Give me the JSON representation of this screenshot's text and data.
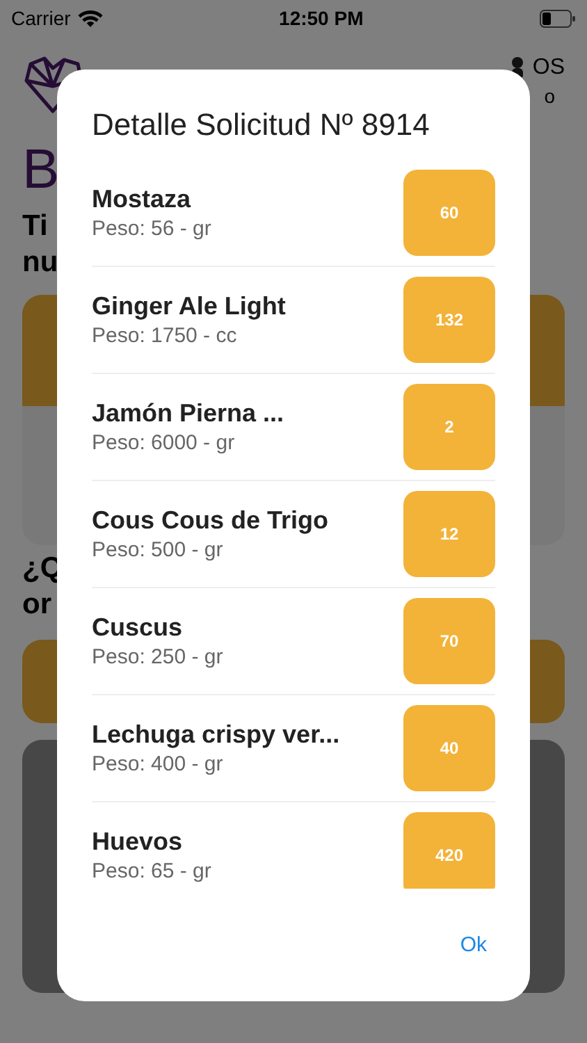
{
  "status_bar": {
    "carrier": "Carrier",
    "time": "12:50 PM"
  },
  "background": {
    "user_fragment": "OS",
    "user_fragment_2": "o",
    "heading_fragment": "B",
    "subtitle_fragments": [
      "Ti",
      "nu"
    ],
    "question_fragments": [
      "¿Q",
      "or"
    ]
  },
  "dialog": {
    "title": "Detalle Solicitud Nº 8914",
    "items": [
      {
        "name": "Mostaza",
        "weight": "Peso: 56 - gr",
        "quantity": "60"
      },
      {
        "name": "Ginger Ale Light",
        "weight": "Peso: 1750 - cc",
        "quantity": "132"
      },
      {
        "name": "Jamón Pierna ...",
        "weight": "Peso: 6000 - gr",
        "quantity": "2"
      },
      {
        "name": "Cous Cous de Trigo",
        "weight": "Peso: 500 - gr",
        "quantity": "12"
      },
      {
        "name": "Cuscus",
        "weight": "Peso: 250 - gr",
        "quantity": "70"
      },
      {
        "name": "Lechuga crispy ver...",
        "weight": "Peso: 400 - gr",
        "quantity": "40"
      },
      {
        "name": "Huevos",
        "weight": "Peso: 65 - gr",
        "quantity": "420"
      }
    ],
    "button": "Ok"
  }
}
